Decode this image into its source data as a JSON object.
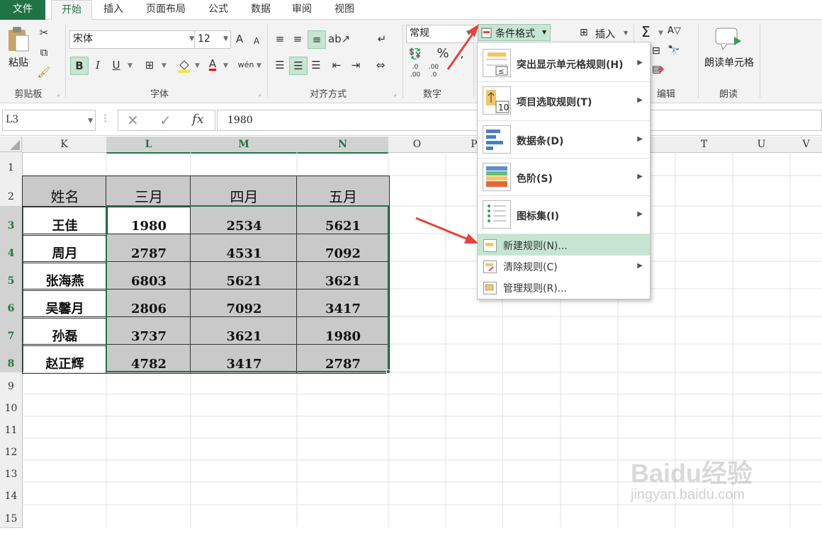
{
  "tabs": [
    "文件",
    "开始",
    "插入",
    "页面布局",
    "公式",
    "数据",
    "审阅",
    "视图"
  ],
  "active_tab": "开始",
  "clipboard": {
    "paste_label": "粘贴",
    "group_label": "剪贴板"
  },
  "font": {
    "name": "宋体",
    "size": "12",
    "bold": "B",
    "italic": "I",
    "underline": "U",
    "group_label": "字体",
    "increase": "A",
    "decrease": "A"
  },
  "alignment": {
    "group_label": "对齐方式"
  },
  "number": {
    "format": "常规",
    "percent": "%",
    "group_label": "数字",
    "inc_decimal": ".0 .00",
    "dec_decimal": ".00 .0"
  },
  "styles": {
    "conditional_format": "条件格式"
  },
  "cells": {
    "insert": "插入"
  },
  "editing": {
    "group_label": "编辑",
    "sigma": "Σ"
  },
  "read": {
    "button_label": "朗读单元格",
    "group_label": "朗读"
  },
  "formula_bar": {
    "name_box": "L3",
    "fx": "fx",
    "value": "1980"
  },
  "columns": [
    "K",
    "L",
    "M",
    "N",
    "O",
    "P",
    "T",
    "U",
    "V"
  ],
  "rows": [
    "1",
    "2",
    "3",
    "4",
    "5",
    "6",
    "7",
    "8",
    "9",
    "10",
    "11",
    "12",
    "13",
    "14",
    "15"
  ],
  "table": {
    "headers": [
      "姓名",
      "三月",
      "四月",
      "五月"
    ],
    "data": [
      [
        "王佳",
        "1980",
        "2534",
        "5621"
      ],
      [
        "周月",
        "2787",
        "4531",
        "7092"
      ],
      [
        "张海燕",
        "6803",
        "5621",
        "3621"
      ],
      [
        "吴馨月",
        "2806",
        "7092",
        "3417"
      ],
      [
        "孙磊",
        "3737",
        "3621",
        "1980"
      ],
      [
        "赵正辉",
        "4782",
        "3417",
        "2787"
      ]
    ]
  },
  "cf_menu": {
    "items": [
      {
        "label": "突出显示单元格规则(H)",
        "icon": "highlight-rules-icon"
      },
      {
        "label": "项目选取规则(T)",
        "icon": "top-bottom-rules-icon",
        "icon_text": "10"
      },
      {
        "label": "数据条(D)",
        "icon": "data-bars-icon"
      },
      {
        "label": "色阶(S)",
        "icon": "color-scales-icon"
      },
      {
        "label": "图标集(I)",
        "icon": "icon-sets-icon"
      }
    ],
    "small_items": [
      {
        "label": "新建规则(N)...",
        "icon": "new-rule-icon"
      },
      {
        "label": "清除规则(C)",
        "icon": "clear-rules-icon"
      },
      {
        "label": "管理规则(R)...",
        "icon": "manage-rules-icon"
      }
    ]
  },
  "watermark": {
    "brand": "Baidu经验",
    "url": "jingyan.baidu.com"
  },
  "colors": {
    "accent": "#217346",
    "selection": "#c6e5d2",
    "arrow": "#e8413a",
    "table_fill": "#c9c9c9"
  }
}
